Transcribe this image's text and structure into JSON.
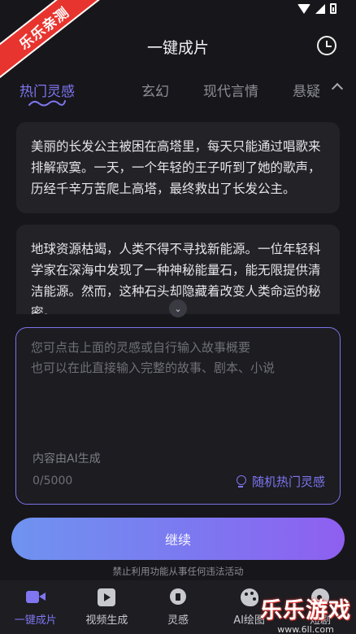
{
  "watermark": {
    "ribbon_text": "乐乐亲测",
    "site_name": "乐乐游戏",
    "site_url": "www.6ll.com"
  },
  "header": {
    "title": "一键成片"
  },
  "tabs": [
    {
      "label": "热门灵感",
      "active": true
    },
    {
      "label": "玄幻",
      "active": false
    },
    {
      "label": "现代言情",
      "active": false
    },
    {
      "label": "悬疑",
      "active": false
    }
  ],
  "ideas": [
    "美丽的长发公主被困在高塔里，每天只能通过唱歌来排解寂寞。一天，一个年轻的王子听到了她的歌声，历经千辛万苦爬上高塔，最终救出了长发公主。",
    "地球资源枯竭，人类不得不寻找新能源。一位年轻科学家在深海中发现了一种神秘能量石，能无限提供清洁能源。然而，这种石头却隐藏着改变人类命运的秘密。"
  ],
  "editor": {
    "placeholder": "您可点击上面的灵感或自行输入故事概要\n也可以在此直接输入完整的故事、剧本、小说",
    "value": "",
    "ai_note": "内容由AI生成",
    "counter": "0/5000",
    "random_label": "随机热门灵感"
  },
  "continue_label": "继续",
  "disclaimer": "禁止利用功能从事任何违法活动",
  "nav": [
    {
      "label": "一键成片",
      "icon": "video-camera-icon",
      "active": true
    },
    {
      "label": "视频生成",
      "icon": "play-box-icon",
      "active": false
    },
    {
      "label": "灵感",
      "icon": "lightbulb-icon",
      "active": false
    },
    {
      "label": "AI绘图",
      "icon": "palette-icon",
      "active": false
    },
    {
      "label": "短剧",
      "icon": "film-icon",
      "active": false
    }
  ],
  "colors": {
    "accent": "#7f76f0",
    "background": "#17171b",
    "card": "#222227"
  }
}
